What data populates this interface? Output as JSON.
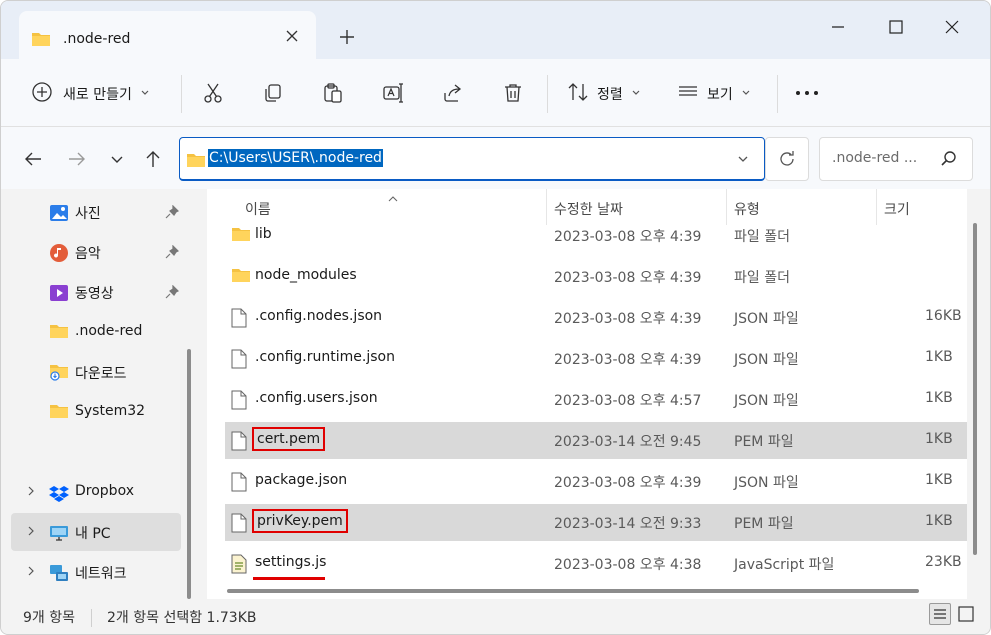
{
  "tab": {
    "title": ".node-red"
  },
  "toolbar": {
    "new_label": "새로 만들기",
    "sort_label": "정렬",
    "view_label": "보기"
  },
  "address": {
    "path": "C:\\Users\\USER\\.node-red"
  },
  "search": {
    "placeholder": ".node-red ..."
  },
  "sidebar": {
    "items": [
      {
        "label": "사진",
        "icon": "photos-icon",
        "pinned": true
      },
      {
        "label": "음악",
        "icon": "music-icon",
        "pinned": true
      },
      {
        "label": "동영상",
        "icon": "video-icon",
        "pinned": true
      },
      {
        "label": ".node-red",
        "icon": "folder-icon"
      },
      {
        "label": "다운로드",
        "icon": "download-folder-icon"
      },
      {
        "label": "System32",
        "icon": "folder-icon"
      },
      {
        "label": "Dropbox",
        "icon": "dropbox-icon"
      },
      {
        "label": "내 PC",
        "icon": "pc-icon",
        "selected": true
      },
      {
        "label": "네트워크",
        "icon": "network-icon"
      }
    ]
  },
  "columns": {
    "name": "이름",
    "date": "수정한 날짜",
    "type": "유형",
    "size": "크기"
  },
  "files": [
    {
      "name": "lib",
      "date": "2023-03-08 오후 4:39",
      "type": "파일 폴더",
      "size": "",
      "icon": "folder-icon"
    },
    {
      "name": "node_modules",
      "date": "2023-03-08 오후 4:39",
      "type": "파일 폴더",
      "size": "",
      "icon": "folder-icon"
    },
    {
      "name": ".config.nodes.json",
      "date": "2023-03-08 오후 4:39",
      "type": "JSON 파일",
      "size": "16KB",
      "icon": "file-icon"
    },
    {
      "name": ".config.runtime.json",
      "date": "2023-03-08 오후 4:39",
      "type": "JSON 파일",
      "size": "1KB",
      "icon": "file-icon"
    },
    {
      "name": ".config.users.json",
      "date": "2023-03-08 오후 4:57",
      "type": "JSON 파일",
      "size": "1KB",
      "icon": "file-icon"
    },
    {
      "name": "cert.pem",
      "date": "2023-03-14 오전 9:45",
      "type": "PEM 파일",
      "size": "1KB",
      "icon": "file-icon",
      "selected": true
    },
    {
      "name": "package.json",
      "date": "2023-03-08 오후 4:39",
      "type": "JSON 파일",
      "size": "1KB",
      "icon": "file-icon"
    },
    {
      "name": "privKey.pem",
      "date": "2023-03-14 오전 9:33",
      "type": "PEM 파일",
      "size": "1KB",
      "icon": "file-icon",
      "selected": true
    },
    {
      "name": "settings.js",
      "date": "2023-03-08 오후 4:38",
      "type": "JavaScript 파일",
      "size": "23KB",
      "icon": "js-file-icon"
    }
  ],
  "status": {
    "count": "9개 항목",
    "selection": "2개 항목 선택함 1.73KB"
  }
}
